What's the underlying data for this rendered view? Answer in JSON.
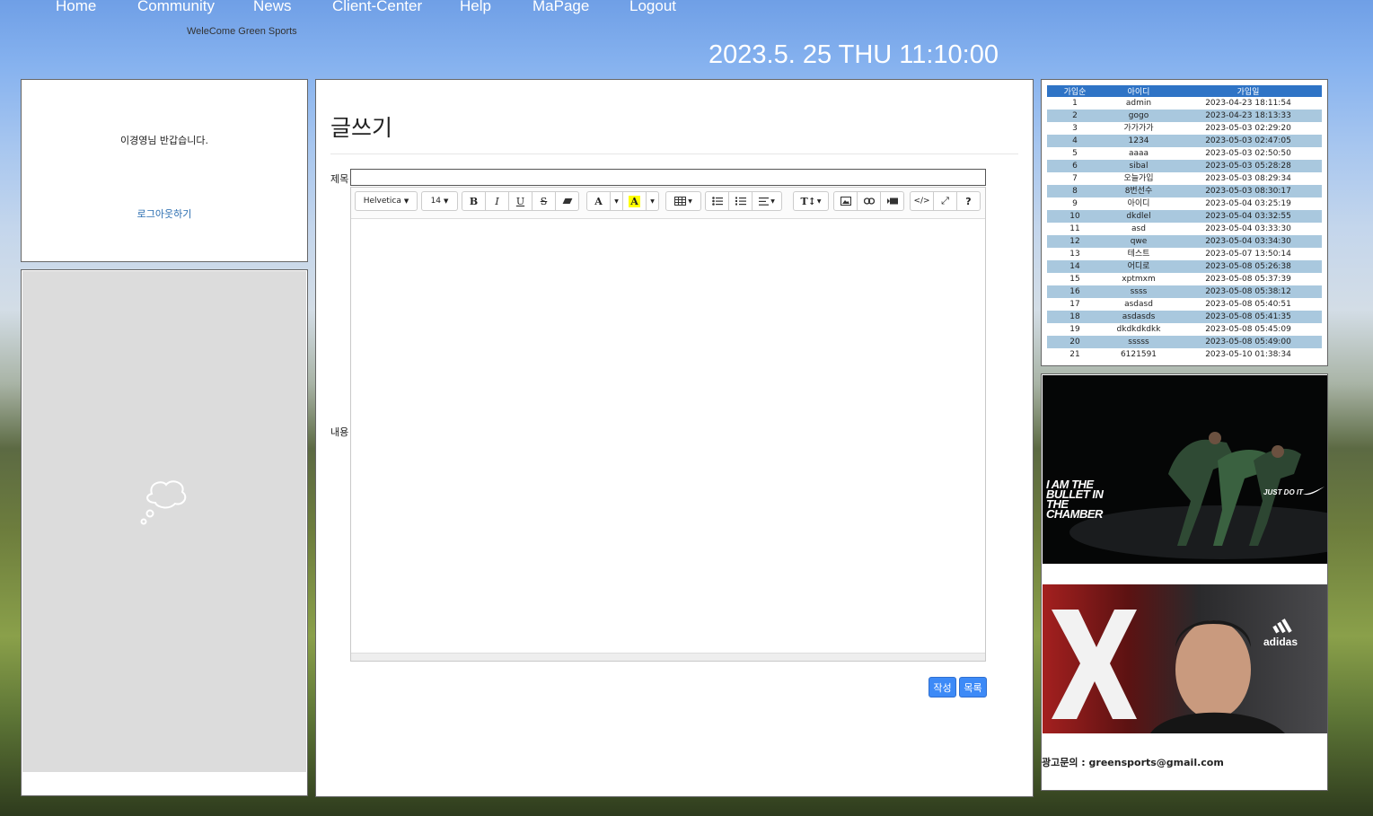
{
  "nav": {
    "items": [
      "Home",
      "Community",
      "News",
      "Client-Center",
      "Help",
      "MaPage",
      "Logout"
    ]
  },
  "header": {
    "tagline": "WeleCome Green Sports",
    "clock": "2023.5. 25 THU 11:10:00"
  },
  "user_box": {
    "greeting": "이경영님 반갑습니다.",
    "logout_label": "로그아웃하기"
  },
  "compose": {
    "title": "글쓰기",
    "subject_label": "제목",
    "content_label": "내용",
    "subject_value": "",
    "toolbar": {
      "font_family": "Helvetica",
      "font_size": "14",
      "bold": "B",
      "italic": "I",
      "underline": "U",
      "strike": "S",
      "help": "?"
    },
    "submit_label": "작성",
    "list_label": "목록"
  },
  "members": {
    "columns": [
      "가입순",
      "아이디",
      "가입일"
    ],
    "rows": [
      [
        "1",
        "admin",
        "2023-04-23 18:11:54"
      ],
      [
        "2",
        "gogo",
        "2023-04-23 18:13:33"
      ],
      [
        "3",
        "가가가가",
        "2023-05-03 02:29:20"
      ],
      [
        "4",
        "1234",
        "2023-05-03 02:47:05"
      ],
      [
        "5",
        "aaaa",
        "2023-05-03 02:50:50"
      ],
      [
        "6",
        "sibal",
        "2023-05-03 05:28:28"
      ],
      [
        "7",
        "오늘가입",
        "2023-05-03 08:29:34"
      ],
      [
        "8",
        "8번선수",
        "2023-05-03 08:30:17"
      ],
      [
        "9",
        "아이디",
        "2023-05-04 03:25:19"
      ],
      [
        "10",
        "dkdlel",
        "2023-05-04 03:32:55"
      ],
      [
        "11",
        "asd",
        "2023-05-04 03:33:30"
      ],
      [
        "12",
        "qwe",
        "2023-05-04 03:34:30"
      ],
      [
        "13",
        "테스트",
        "2023-05-07 13:50:14"
      ],
      [
        "14",
        "어디로",
        "2023-05-08 05:26:38"
      ],
      [
        "15",
        "xptmxm",
        "2023-05-08 05:37:39"
      ],
      [
        "16",
        "ssss",
        "2023-05-08 05:38:12"
      ],
      [
        "17",
        "asdasd",
        "2023-05-08 05:40:51"
      ],
      [
        "18",
        "asdasds",
        "2023-05-08 05:41:35"
      ],
      [
        "19",
        "dkdkdkdkk",
        "2023-05-08 05:45:09"
      ],
      [
        "20",
        "sssss",
        "2023-05-08 05:49:00"
      ],
      [
        "21",
        "6121591",
        "2023-05-10 01:38:34"
      ]
    ]
  },
  "ads": {
    "ad1_text": "I AM THE BULLET IN THE CHAMBER",
    "ad1_slogan": "JUST DO IT",
    "ad2_brand": "adidas",
    "contact": "광고문의 : greensports@gmail.com"
  },
  "colors": {
    "accent": "#3d8af7",
    "table_header": "#2f74c6",
    "table_alt_row": "#a9c8de",
    "link": "#2a6db0"
  }
}
